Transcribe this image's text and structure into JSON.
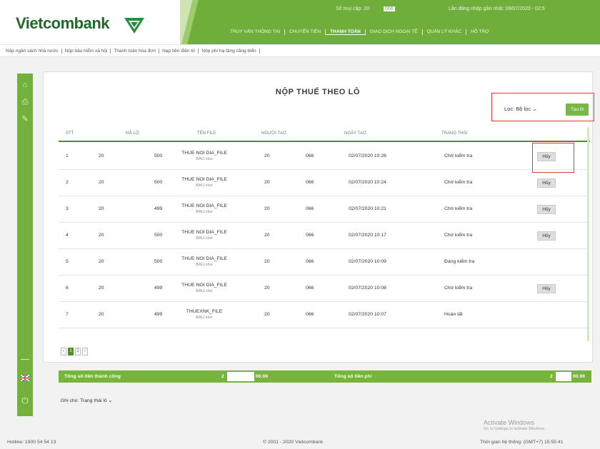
{
  "brand": {
    "name": "Vietcombank"
  },
  "header": {
    "login_count_label": "Số truy cập: 20",
    "login_count_hidden": "066",
    "last_login": "Lần đăng nhập gần nhất: 09/07/2020 - 02:5",
    "menu": [
      "TRUY VẤN THÔNG TIN",
      "CHUYỂN TIỀN",
      "THANH TOÁN",
      "GIAO DỊCH NGOẠI TỆ",
      "QUẢN LÝ KHÁC",
      "HỖ TRỢ"
    ],
    "active_menu": "THANH TOÁN"
  },
  "submenu": [
    "Nộp ngân sách nhà nước",
    "Nộp bảo hiểm xã hội",
    "Thanh toán hóa đơn",
    "Nạp tiền điện tử",
    "Nộp phí hạ tầng cảng biển"
  ],
  "page": {
    "title": "NỘP THUẾ THEO LÔ"
  },
  "filter": {
    "selected": "Lọc: Bộ lọc",
    "button": "Tạo lô"
  },
  "table": {
    "headers": [
      "STT",
      "MÃ LÔ",
      "TÊN FILE",
      "NGƯỜI TẠO",
      "NGÀY TẠO",
      "TRẠNG THÁI"
    ],
    "rows": [
      {
        "stt": "1",
        "ma1": "20",
        "ma2": "500",
        "file": "THUE NOI DIA_FILE",
        "ext": "BAU.xlsx",
        "u1": "20",
        "u2": "066",
        "date": "02/07/2020 10:26",
        "status": "Chờ kiểm tra",
        "action": "Hủy"
      },
      {
        "stt": "2",
        "ma1": "20",
        "ma2": "500",
        "file": "THUE NOI DIA_FILE",
        "ext": "BAU.xlsx",
        "u1": "20",
        "u2": "066",
        "date": "02/07/2020 10:24",
        "status": "Chờ kiểm tra",
        "action": "Hủy"
      },
      {
        "stt": "3",
        "ma1": "20",
        "ma2": "499",
        "file": "THUE NOI DIA_FILE",
        "ext": "BAU.xlsx",
        "u1": "20",
        "u2": "066",
        "date": "02/07/2020 10:21",
        "status": "Chờ kiểm tra",
        "action": "Hủy"
      },
      {
        "stt": "4",
        "ma1": "20",
        "ma2": "500",
        "file": "THUE NOI DIA_FILE",
        "ext": "BAU.xlsx",
        "u1": "20",
        "u2": "066",
        "date": "02/07/2020 10:17",
        "status": "Chờ kiểm tra",
        "action": "Hủy"
      },
      {
        "stt": "5",
        "ma1": "20",
        "ma2": "500",
        "file": "THUE NOI DIA_FILE",
        "ext": "BAU.xlsx",
        "u1": "20",
        "u2": "066",
        "date": "02/07/2020 10:09",
        "status": "Đang kiểm tra",
        "action": ""
      },
      {
        "stt": "6",
        "ma1": "20",
        "ma2": "499",
        "file": "THUE NOI DIA_FILE",
        "ext": "BAU.xlsx",
        "u1": "20",
        "u2": "066",
        "date": "02/07/2020 10:08",
        "status": "Chờ kiểm tra",
        "action": "Hủy"
      },
      {
        "stt": "7",
        "ma1": "20",
        "ma2": "499",
        "file": "THUEXNK_FILE",
        "ext": "BAU.xlsx",
        "u1": "20",
        "u2": "066",
        "date": "02/07/2020 10:07",
        "status": "Hoàn tất",
        "action": ""
      }
    ]
  },
  "pagination": {
    "prev": "‹",
    "pages": [
      "1",
      "2"
    ],
    "next": "›",
    "current": "1"
  },
  "totals": {
    "amount_label": "Tổng số tiền thành công",
    "amount_prefix": "2",
    "amount_suffix": "00.00",
    "fee_label": "Tổng số tiền phí",
    "fee_prefix": "2",
    "fee_suffix": "00.00"
  },
  "note": "Ghi chú: Trạng thái lô",
  "activate": {
    "title": "Activate Windows",
    "subtitle": "Go to Settings to activate Windows."
  },
  "footer": {
    "hotline": "Hotline: 1900 54 54 13",
    "copyright": "© 2001 - 2020 Vietcombank",
    "time": "Thời gian hệ thống: (GMT+7) 15:55:41"
  },
  "colors": {
    "brand_green": "#6fae3a",
    "dark_green": "#1f6a2a",
    "highlight": "#e53935"
  }
}
